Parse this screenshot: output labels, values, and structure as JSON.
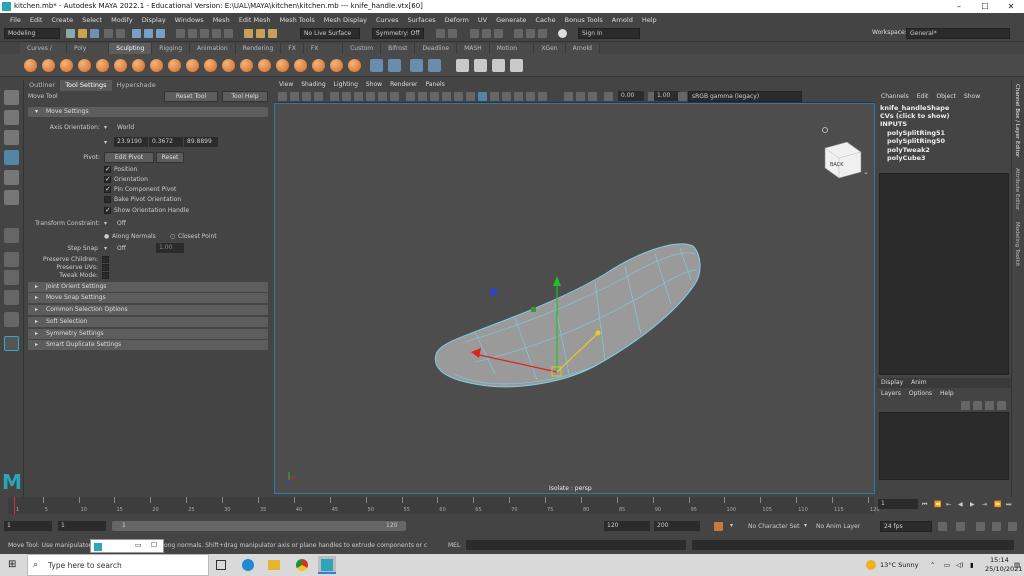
{
  "window": {
    "title": "kitchen.mb* - Autodesk MAYA 2022.1 - Educational Version: E:\\UAL\\MAYA\\kitchen\\kitchen.mb  ---  knife_handle.vtx[60]",
    "minimize": "–",
    "maximize": "☐",
    "close": "✕"
  },
  "menubar": [
    "File",
    "Edit",
    "Create",
    "Select",
    "Modify",
    "Display",
    "Windows",
    "Mesh",
    "Edit Mesh",
    "Mesh Tools",
    "Mesh Display",
    "Curves",
    "Surfaces",
    "Deform",
    "UV",
    "Generate",
    "Cache",
    "Bonus Tools",
    "Arnold",
    "Help"
  ],
  "statusline": {
    "mode": "Modeling",
    "live_surface": "No Live Surface",
    "symmetry": "Symmetry: Off",
    "sign_in": "Sign In",
    "workspace_label": "Workspace:",
    "workspace_value": "General*"
  },
  "shelf_tabs": [
    {
      "label": "Curves / Surfaces"
    },
    {
      "label": "Poly Modeling"
    },
    {
      "label": "Sculpting",
      "active": true
    },
    {
      "label": "Rigging"
    },
    {
      "label": "Animation"
    },
    {
      "label": "Rendering"
    },
    {
      "label": "FX"
    },
    {
      "label": "FX Caching"
    },
    {
      "label": "Custom"
    },
    {
      "label": "Bifrost"
    },
    {
      "label": "Deadline"
    },
    {
      "label": "MASH"
    },
    {
      "label": "Motion Graphics"
    },
    {
      "label": "XGen"
    },
    {
      "label": "Arnold"
    }
  ],
  "tool_panel": {
    "tabs": [
      "Outliner",
      "Tool Settings",
      "Hypershade"
    ],
    "active_tab": "Tool Settings",
    "tool_name": "Move Tool",
    "reset_tool": "Reset Tool",
    "tool_help": "Tool Help",
    "move_settings": "Move Settings",
    "axis_orientation_label": "Axis Orientation:",
    "axis_orientation_value": "World",
    "axis_values": [
      "23.9190",
      "0.3672",
      "89.8899"
    ],
    "pivot_label": "Pivot:",
    "edit_pivot": "Edit Pivot",
    "reset": "Reset",
    "checks": [
      {
        "label": "Position",
        "on": true
      },
      {
        "label": "Orientation",
        "on": true
      },
      {
        "label": "Pin Component Pivot",
        "on": true
      },
      {
        "label": "Bake Pivot Orientation",
        "on": false
      },
      {
        "label": "Show Orientation Handle",
        "on": true
      }
    ],
    "transform_constraint_label": "Transform Constraint:",
    "transform_constraint_value": "Off",
    "along_normals": "Along Normals",
    "closest_point": "Closest Point",
    "step_snap_label": "Step Snap",
    "step_snap_value": "Off",
    "step_snap_num": "1.00",
    "preserve_children": "Preserve Children:",
    "preserve_uvs": "Preserve UVs:",
    "tweak_mode": "Tweak Mode:",
    "sections": [
      "Joint Orient Settings",
      "Move Snap Settings",
      "Common Selection Options",
      "Soft Selection",
      "Symmetry Settings",
      "Smart Duplicate Settings"
    ]
  },
  "viewport": {
    "menu": [
      "View",
      "Shading",
      "Lighting",
      "Show",
      "Renderer",
      "Panels"
    ],
    "exposure": "0.00",
    "gamma": "1.00",
    "color_space": "sRGB gamma (legacy)",
    "camera_label": "Isolate : persp",
    "cube_label": "BACK"
  },
  "channel_box": {
    "tabs": [
      "Channels",
      "Edit",
      "Object",
      "Show"
    ],
    "shape": "knife_handleShape",
    "cvs": "CVs (click to show)",
    "inputs": "INPUTS",
    "nodes": [
      "polySplitRing51",
      "polySplitRing50",
      "polyTweak2",
      "polyCube3"
    ]
  },
  "layer_editor": {
    "tabs": [
      "Display",
      "Anim"
    ],
    "menu": [
      "Layers",
      "Options",
      "Help"
    ]
  },
  "side_tabs": [
    "Channel Box / Layer Editor",
    "Attribute Editor",
    "Modeling Toolkit"
  ],
  "timeslider": {
    "ticks": [
      "1",
      "5",
      "10",
      "15",
      "20",
      "25",
      "30",
      "35",
      "40",
      "45",
      "50",
      "55",
      "60",
      "65",
      "70",
      "75",
      "80",
      "85",
      "90",
      "95",
      "100",
      "105",
      "110",
      "115",
      "120"
    ],
    "current_frame": "1"
  },
  "range_slider": {
    "start": "1",
    "start2": "1",
    "range_inner_start": "1",
    "range_inner_end": "120",
    "end": "120",
    "end2": "200",
    "character_set": "No Character Set",
    "anim_layer": "No Anim Layer",
    "fps": "24 fps"
  },
  "command_line": {
    "help_text": "Move Tool: Use manipulator to move components along normals. Shift+drag manipulator axis or plane handles to extrude components or c",
    "mel": "MEL"
  },
  "taskbar": {
    "search_placeholder": "Type here to search",
    "weather": "13°C  Sunny",
    "time": "15:14",
    "date": "25/10/2021"
  },
  "colors": {
    "accent": "#5285a6",
    "mesh_wire": "#7fd0e6",
    "mesh_fill": "#9a9a9a",
    "orange_icon": "#e08a3c"
  }
}
